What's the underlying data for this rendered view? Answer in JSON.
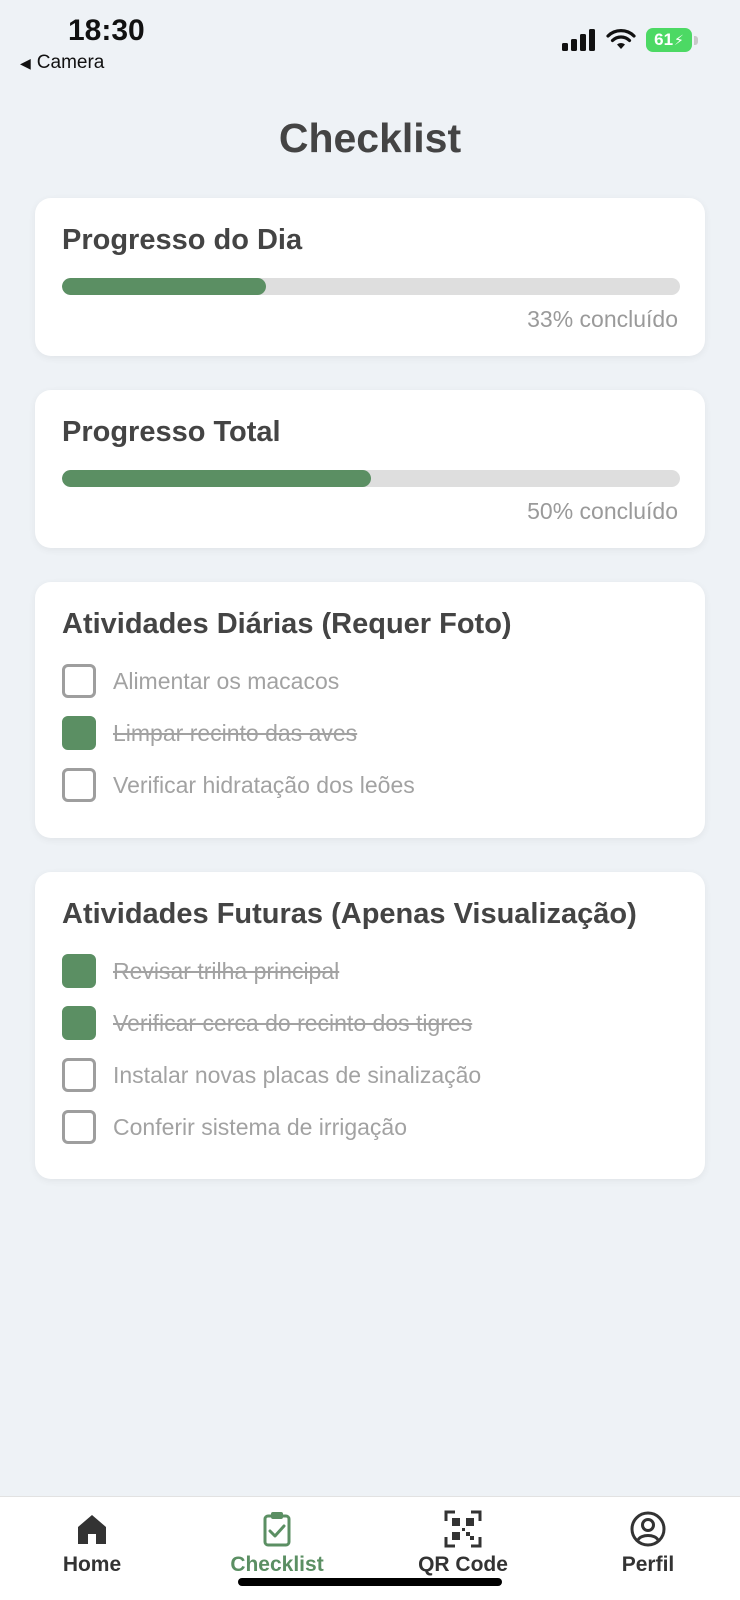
{
  "status_bar": {
    "time": "18:30",
    "back_label": "Camera",
    "battery": "61"
  },
  "page": {
    "title": "Checklist"
  },
  "daily_progress": {
    "title": "Progresso do Dia",
    "percent": 33,
    "label": "33% concluído"
  },
  "total_progress": {
    "title": "Progresso Total",
    "percent": 50,
    "label": "50% concluído"
  },
  "daily_activities": {
    "title": "Atividades Diárias (Requer Foto)",
    "items": [
      {
        "label": "Alimentar os macacos",
        "checked": false
      },
      {
        "label": "Limpar recinto das aves",
        "checked": true
      },
      {
        "label": "Verificar hidratação dos leões",
        "checked": false
      }
    ]
  },
  "future_activities": {
    "title": "Atividades Futuras (Apenas Visualização)",
    "items": [
      {
        "label": "Revisar trilha principal",
        "checked": true
      },
      {
        "label": "Verificar cerca do recinto dos tigres",
        "checked": true
      },
      {
        "label": "Instalar novas placas de sinalização",
        "checked": false
      },
      {
        "label": "Conferir sistema de irrigação",
        "checked": false
      }
    ]
  },
  "bottom_nav": {
    "items": [
      {
        "label": "Home",
        "icon": "home-icon"
      },
      {
        "label": "Checklist",
        "icon": "clipboard-check-icon",
        "active": true
      },
      {
        "label": "QR Code",
        "icon": "qr-code-icon"
      },
      {
        "label": "Perfil",
        "icon": "user-circle-icon"
      }
    ]
  },
  "colors": {
    "accent": "#5b8f63",
    "background": "#eef2f6",
    "track": "#dedede"
  }
}
